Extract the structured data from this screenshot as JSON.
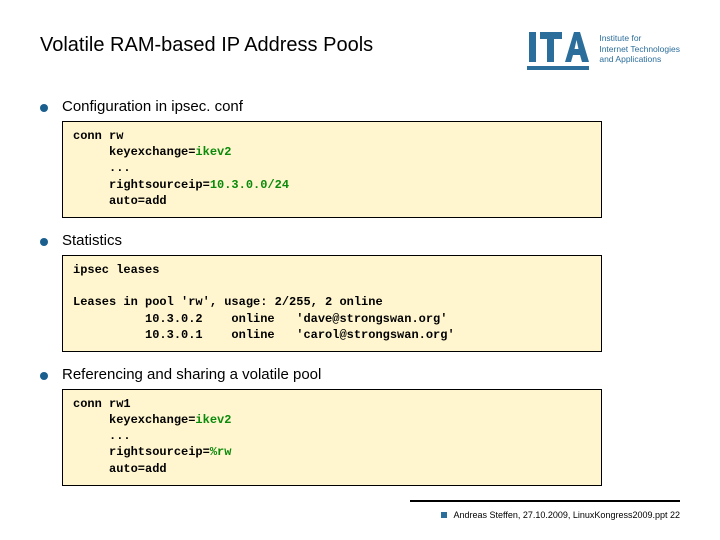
{
  "title": "Volatile RAM-based IP Address Pools",
  "logo": {
    "name": "ita",
    "subtitle_l1": "Institute for",
    "subtitle_l2": "Internet Technologies",
    "subtitle_l3": "and Applications"
  },
  "sections": [
    {
      "heading": "Configuration in ipsec. conf",
      "code": {
        "l1a": "conn rw",
        "l2a": "     keyexchange=",
        "l2b": "ikev2",
        "l3a": "     ...",
        "l4a": "     rightsourceip=",
        "l4b": "10.3.0.0/24",
        "l5a": "     auto=add"
      }
    },
    {
      "heading": "Statistics",
      "code": {
        "l1a": "ipsec leases",
        "blank": " ",
        "l2a": "Leases in pool 'rw', usage: 2/255, 2 online",
        "l3a": "          10.3.0.2    online   'dave@strongswan.org'",
        "l4a": "          10.3.0.1    online   'carol@strongswan.org'"
      }
    },
    {
      "heading": "Referencing and sharing a volatile pool",
      "code": {
        "l1a": "conn rw1",
        "l2a": "     keyexchange=",
        "l2b": "ikev2",
        "l3a": "     ...",
        "l4a": "     rightsourceip=",
        "l4b": "%rw",
        "l5a": "     auto=add"
      }
    }
  ],
  "footer": "Andreas Steffen, 27.10.2009, LinuxKongress2009.ppt 22"
}
